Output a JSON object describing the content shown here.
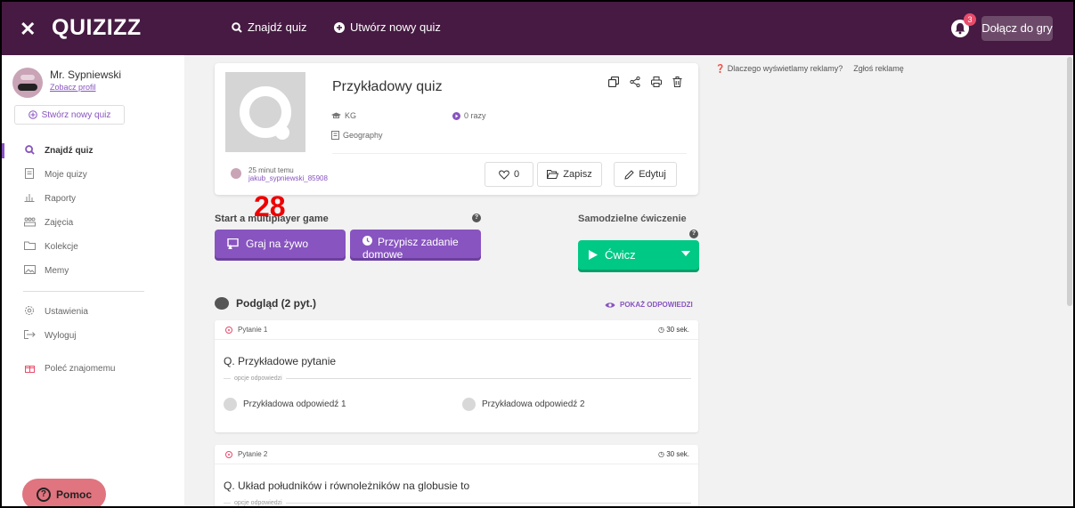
{
  "topbar": {
    "close_glyph": "✕",
    "logo": "QUIZIZZ",
    "find_quiz": "Znajdź quiz",
    "create_quiz": "Utwórz nowy quiz",
    "notifications_count": "3",
    "join_game": "Dołącz do gry"
  },
  "sidebar": {
    "user_name": "Mr. Sypniewski",
    "view_profile": "Zobacz profil",
    "create_quiz": "Stwórz nowy quiz",
    "items": [
      {
        "label": "Znajdź quiz",
        "icon": "search-icon"
      },
      {
        "label": "Moje quizy",
        "icon": "document-icon"
      },
      {
        "label": "Raporty",
        "icon": "bar-chart-icon"
      },
      {
        "label": "Zajęcia",
        "icon": "class-icon"
      },
      {
        "label": "Kolekcje",
        "icon": "folder-icon"
      },
      {
        "label": "Memy",
        "icon": "image-icon"
      },
      {
        "label": "Ustawienia",
        "icon": "gear-icon"
      },
      {
        "label": "Wyloguj",
        "icon": "logout-icon"
      },
      {
        "label": "Poleć znajomemu",
        "icon": "gift-icon"
      }
    ],
    "help": "Pomoc"
  },
  "quiz": {
    "title": "Przykładowy quiz",
    "grade": "KG",
    "plays": "0 razy",
    "subject": "Geography",
    "author_time": "25 minut temu",
    "author_name": "jakub_sypniewski_85908",
    "likes": "0",
    "save": "Zapisz",
    "edit": "Edytuj"
  },
  "actions": {
    "start_label": "Start a multiplayer game",
    "practice_label": "Samodzielne ćwiczenie",
    "overlay_number": "28",
    "live": "Graj na żywo",
    "homework": "Przypisz zadanie domowe",
    "practice": "Ćwicz"
  },
  "preview": {
    "heading": "Podgląd (2 pyt.)",
    "show_answers": "POKAŻ ODPOWIEDZI",
    "options_label": "opcje odpowiedzi",
    "questions": [
      {
        "num": "Pytanie 1",
        "time": "30 sek.",
        "text": "Q. Przykładowe pytanie",
        "answers": [
          "Przykładowa odpowiedź 1",
          "Przykładowa odpowiedź 2"
        ]
      },
      {
        "num": "Pytanie 2",
        "time": "30 sek.",
        "text": "Q. Układ południków i równoleżników na globusie to"
      }
    ]
  },
  "ads": {
    "why": "Dlaczego wyświetlamy reklamy?",
    "report": "Zgłoś reklamę"
  },
  "colors": {
    "topbar": "#461a42",
    "accent": "#8854c0",
    "practice": "#00c985",
    "help": "#e0747f"
  }
}
